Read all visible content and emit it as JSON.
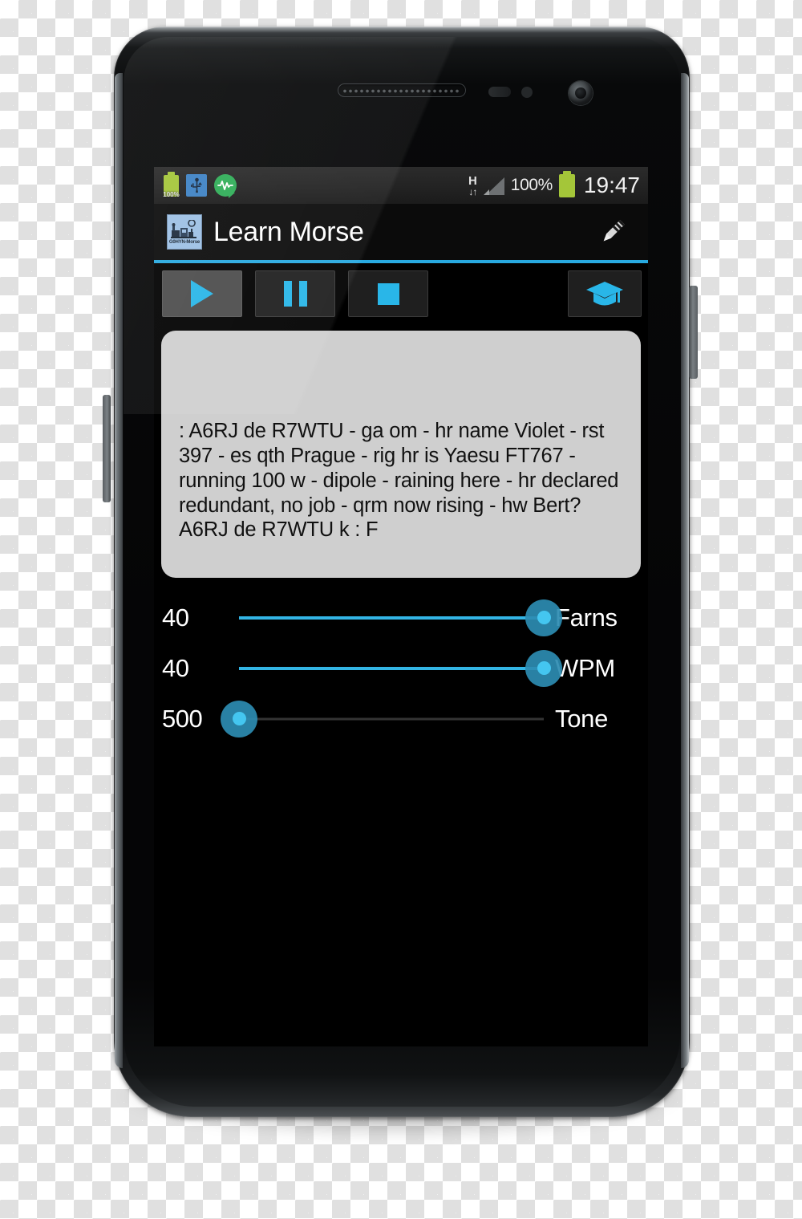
{
  "statusbar": {
    "left_icons": [
      {
        "name": "battery-small-icon",
        "label": "100%"
      },
      {
        "name": "usb-icon",
        "label": ""
      },
      {
        "name": "audio-waveform-icon",
        "label": ""
      }
    ],
    "network_type": "H",
    "network_arrows": "↓↑",
    "battery_percent": "100%",
    "clock": "19:47"
  },
  "actionbar": {
    "app_icon_caption": "G0HYN-Morse",
    "title": "Learn Morse",
    "edit_icon": "pencil-icon"
  },
  "toolbar": {
    "buttons": [
      {
        "name": "play-button",
        "icon": "play-icon",
        "active": true
      },
      {
        "name": "pause-button",
        "icon": "pause-icon",
        "active": false
      },
      {
        "name": "stop-button",
        "icon": "stop-icon",
        "active": false
      }
    ],
    "learn_button": {
      "name": "learn-button",
      "icon": "graduation-cap-icon"
    }
  },
  "text_panel": {
    "content": ": A6RJ de R7WTU - ga om - hr name Violet - rst 397 - es qth Prague - rig hr is Yaesu FT767 - running 100 w - dipole - raining here - hr declared redundant, no job - qrm now rising - hw Bert?\nA6RJ de R7WTU k\n: F"
  },
  "sliders": [
    {
      "value": "40",
      "label": "Farns",
      "percent": 100
    },
    {
      "value": "40",
      "label": "WPM",
      "percent": 100
    },
    {
      "value": "500",
      "label": "Tone",
      "percent": 0
    }
  ],
  "colors": {
    "accent": "#33b5e5",
    "accent_bar": "#28a9e0",
    "panel_bg": "#cfcfcf",
    "battery_green": "#a4c639",
    "screen_bg": "#000000"
  }
}
